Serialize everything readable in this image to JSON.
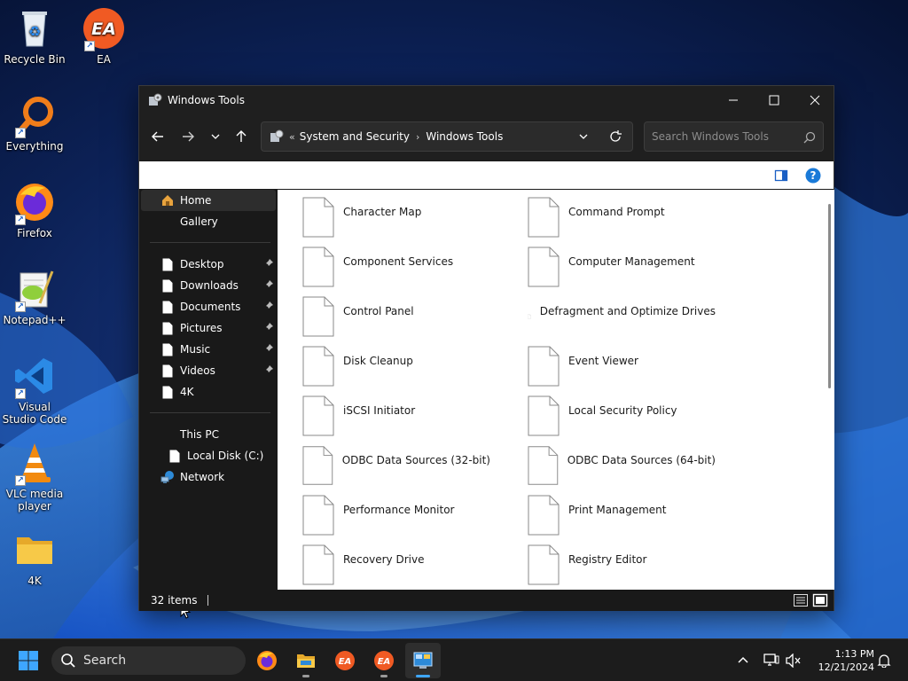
{
  "desktop": {
    "icons": [
      {
        "label": "Recycle Bin",
        "icon": "recycle-bin-icon"
      },
      {
        "label": "EA",
        "icon": "ea-icon"
      },
      {
        "label": "Everything",
        "icon": "everything-search-icon"
      },
      {
        "label": "Firefox",
        "icon": "firefox-icon"
      },
      {
        "label": "Notepad++",
        "icon": "notepad-plus-plus-icon"
      },
      {
        "label": "Visual Studio Code",
        "icon": "vscode-icon"
      },
      {
        "label": "VLC media player",
        "icon": "vlc-icon"
      },
      {
        "label": "4K",
        "icon": "folder-icon"
      }
    ]
  },
  "window": {
    "title": "Windows Tools",
    "controls": {
      "minimize": "minimize-icon",
      "maximize": "maximize-icon",
      "close": "close-icon"
    },
    "address": {
      "overflow": "«",
      "crumbs": [
        "System and Security",
        "Windows Tools"
      ]
    },
    "search": {
      "placeholder": "Search Windows Tools"
    },
    "nav": {
      "home": "Home",
      "gallery": "Gallery",
      "quick_access": [
        {
          "label": "Desktop",
          "pinned": true
        },
        {
          "label": "Downloads",
          "pinned": true
        },
        {
          "label": "Documents",
          "pinned": true
        },
        {
          "label": "Pictures",
          "pinned": true
        },
        {
          "label": "Music",
          "pinned": true
        },
        {
          "label": "Videos",
          "pinned": true
        },
        {
          "label": "4K",
          "pinned": false
        }
      ],
      "this_pc": "This PC",
      "local_disk": "Local Disk (C:)",
      "network": "Network"
    },
    "items": [
      "Character Map",
      "Command Prompt",
      "Component Services",
      "Computer Management",
      "Control Panel",
      "Defragment and Optimize Drives",
      "Disk Cleanup",
      "Event Viewer",
      "iSCSI Initiator",
      "Local Security Policy",
      "ODBC Data Sources (32-bit)",
      "ODBC Data Sources (64-bit)",
      "Performance Monitor",
      "Print Management",
      "Recovery Drive",
      "Registry Editor"
    ],
    "status": {
      "count": "32 items"
    }
  },
  "taskbar": {
    "search_label": "Search",
    "apps": [
      "firefox-icon",
      "file-explorer-icon",
      "ea-icon",
      "ea-icon",
      "control-panel-icon"
    ],
    "time": "1:13 PM",
    "date": "12/21/2024"
  },
  "colors": {
    "accent": "#0078d4",
    "window_bg": "#191919",
    "content_bg": "#ffffff",
    "taskbar_bg": "#1c1c1c"
  }
}
